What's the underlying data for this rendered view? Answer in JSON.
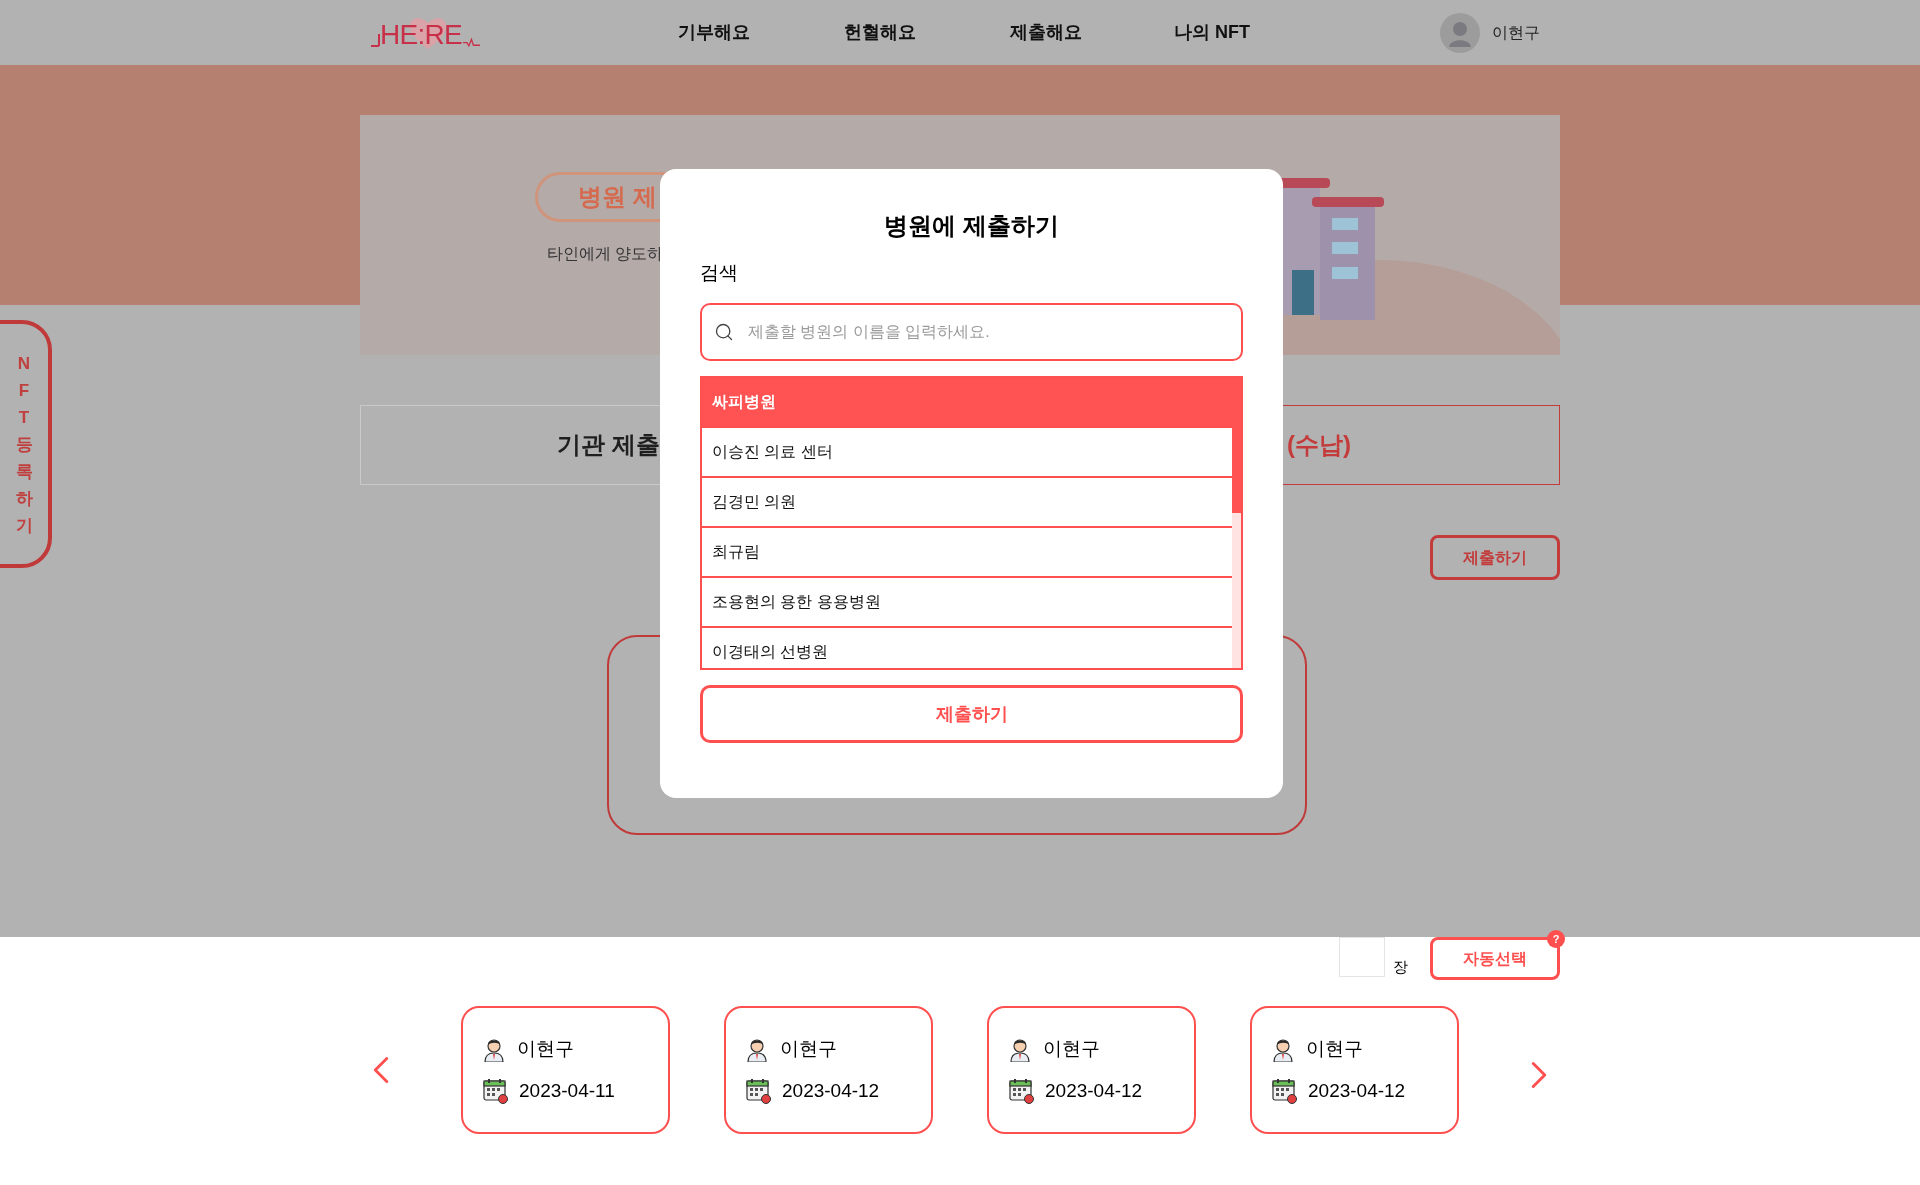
{
  "header": {
    "logo": "HE:RE",
    "nav": [
      {
        "label": "기부해요"
      },
      {
        "label": "헌혈해요"
      },
      {
        "label": "제출해요"
      },
      {
        "label": "나의 NFT"
      }
    ],
    "user": {
      "name": "이현구"
    }
  },
  "side_tab": {
    "label": "NFT등록하기"
  },
  "hero": {
    "badge": "병원 제",
    "description": "타인에게 양도하"
  },
  "tabs": [
    {
      "label": "기관 제출",
      "selected": false
    },
    {
      "label": "(수납)",
      "selected": true
    }
  ],
  "submit_button": "제출하기",
  "modal": {
    "title": "병원에 제출하기",
    "search_label": "검색",
    "search": {
      "placeholder": "제출할 병원의 이름을 입력하세요."
    },
    "hospitals": [
      {
        "name": "싸피병원",
        "selected": true
      },
      {
        "name": "이승진 의료 센터",
        "selected": false
      },
      {
        "name": "김경민 의원",
        "selected": false
      },
      {
        "name": "최규림",
        "selected": false
      },
      {
        "name": "조용현의 용한 용용병원",
        "selected": false
      },
      {
        "name": "이경태의 선병원",
        "selected": false
      }
    ],
    "submit": "제출하기"
  },
  "auto_select": {
    "unit": "장",
    "button": "자동선택",
    "help_badge": "?"
  },
  "records": [
    {
      "name": "이현구",
      "date": "2023-04-11"
    },
    {
      "name": "이현구",
      "date": "2023-04-12"
    },
    {
      "name": "이현구",
      "date": "2023-04-12"
    },
    {
      "name": "이현구",
      "date": "2023-04-12"
    }
  ]
}
